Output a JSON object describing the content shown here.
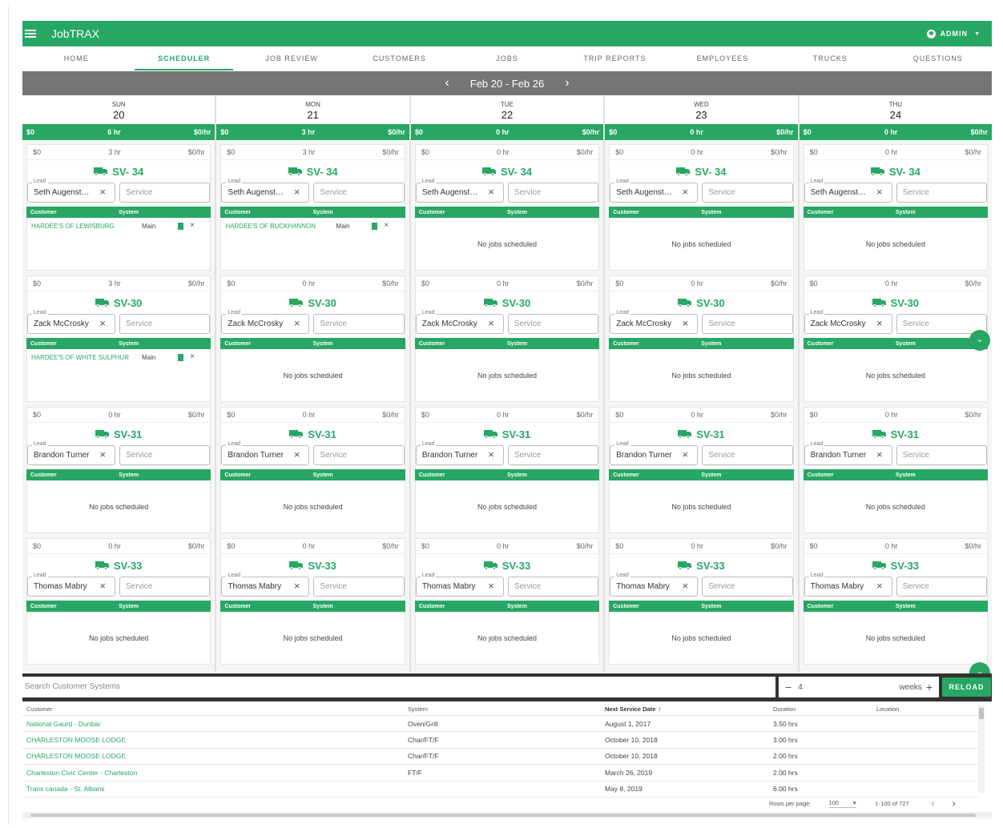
{
  "app": {
    "title": "JobTRAX",
    "user_label": "ADMIN"
  },
  "tabs": [
    "HOME",
    "SCHEDULER",
    "JOB REVIEW",
    "CUSTOMERS",
    "JOBS",
    "TRIP REPORTS",
    "EMPLOYEES",
    "TRUCKS",
    "QUESTIONS"
  ],
  "active_tab": "SCHEDULER",
  "week": {
    "label": "Feb 20 - Feb 26",
    "prev_icon": "chevron-left",
    "next_icon": "chevron-right"
  },
  "table_header": {
    "customer": "Customer",
    "system": "System"
  },
  "lead_label": "Lead",
  "service_placeholder": "Service",
  "empty_message": "No jobs scheduled",
  "colors": {
    "brand": "#27a763",
    "week_bar": "#757575",
    "bottom_bar": "#333333"
  },
  "days": [
    {
      "name": "SUN",
      "date": "20",
      "totals": {
        "revenue": "$0",
        "hours": "6 hr",
        "rate": "$0/hr"
      },
      "trucks": [
        {
          "name": "SV- 34",
          "revenue": "$0",
          "hours": "3 hr",
          "rate": "$0/hr",
          "lead": "Seth Augenstein",
          "jobs": [
            {
              "customer": "HARDEE'S OF LEWISBURG",
              "system": "Main"
            }
          ]
        },
        {
          "name": "SV-30",
          "revenue": "$0",
          "hours": "3 hr",
          "rate": "$0/hr",
          "lead": "Zack McCrosky",
          "jobs": [
            {
              "customer": "HARDEE'S OF WHITE SULPHUR",
              "system": "Main"
            }
          ]
        },
        {
          "name": "SV-31",
          "revenue": "$0",
          "hours": "0 hr",
          "rate": "$0/hr",
          "lead": "Brandon Turner",
          "jobs": []
        },
        {
          "name": "SV-33",
          "revenue": "$0",
          "hours": "0 hr",
          "rate": "$0/hr",
          "lead": "Thomas Mabry",
          "jobs": []
        }
      ]
    },
    {
      "name": "MON",
      "date": "21",
      "totals": {
        "revenue": "$0",
        "hours": "3 hr",
        "rate": "$0/hr"
      },
      "trucks": [
        {
          "name": "SV- 34",
          "revenue": "$0",
          "hours": "3 hr",
          "rate": "$0/hr",
          "lead": "Seth Augenstein",
          "jobs": [
            {
              "customer": "HARDEE'S OF BUCKHANNON",
              "system": "Main"
            }
          ]
        },
        {
          "name": "SV-30",
          "revenue": "$0",
          "hours": "0 hr",
          "rate": "$0/hr",
          "lead": "Zack McCrosky",
          "jobs": []
        },
        {
          "name": "SV-31",
          "revenue": "$0",
          "hours": "0 hr",
          "rate": "$0/hr",
          "lead": "Brandon Turner",
          "jobs": []
        },
        {
          "name": "SV-33",
          "revenue": "$0",
          "hours": "0 hr",
          "rate": "$0/hr",
          "lead": "Thomas Mabry",
          "jobs": []
        }
      ]
    },
    {
      "name": "TUE",
      "date": "22",
      "totals": {
        "revenue": "$0",
        "hours": "0 hr",
        "rate": "$0/hr"
      },
      "trucks": [
        {
          "name": "SV- 34",
          "revenue": "$0",
          "hours": "0 hr",
          "rate": "$0/hr",
          "lead": "Seth Augenstein",
          "jobs": []
        },
        {
          "name": "SV-30",
          "revenue": "$0",
          "hours": "0 hr",
          "rate": "$0/hr",
          "lead": "Zack McCrosky",
          "jobs": []
        },
        {
          "name": "SV-31",
          "revenue": "$0",
          "hours": "0 hr",
          "rate": "$0/hr",
          "lead": "Brandon Turner",
          "jobs": []
        },
        {
          "name": "SV-33",
          "revenue": "$0",
          "hours": "0 hr",
          "rate": "$0/hr",
          "lead": "Thomas Mabry",
          "jobs": []
        }
      ]
    },
    {
      "name": "WED",
      "date": "23",
      "totals": {
        "revenue": "$0",
        "hours": "0 hr",
        "rate": "$0/hr"
      },
      "trucks": [
        {
          "name": "SV- 34",
          "revenue": "$0",
          "hours": "0 hr",
          "rate": "$0/hr",
          "lead": "Seth Augenstein",
          "jobs": []
        },
        {
          "name": "SV-30",
          "revenue": "$0",
          "hours": "0 hr",
          "rate": "$0/hr",
          "lead": "Zack McCrosky",
          "jobs": []
        },
        {
          "name": "SV-31",
          "revenue": "$0",
          "hours": "0 hr",
          "rate": "$0/hr",
          "lead": "Brandon Turner",
          "jobs": []
        },
        {
          "name": "SV-33",
          "revenue": "$0",
          "hours": "0 hr",
          "rate": "$0/hr",
          "lead": "Thomas Mabry",
          "jobs": []
        }
      ]
    },
    {
      "name": "THU",
      "date": "24",
      "totals": {
        "revenue": "$0",
        "hours": "0 hr",
        "rate": "$0/hr"
      },
      "trucks": [
        {
          "name": "SV- 34",
          "revenue": "$0",
          "hours": "0 hr",
          "rate": "$0/hr",
          "lead": "Seth Augenstein",
          "jobs": []
        },
        {
          "name": "SV-30",
          "revenue": "$0",
          "hours": "0 hr",
          "rate": "$0/hr",
          "lead": "Zack McCrosky",
          "jobs": []
        },
        {
          "name": "SV-31",
          "revenue": "$0",
          "hours": "0 hr",
          "rate": "$0/hr",
          "lead": "Brandon Turner",
          "jobs": []
        },
        {
          "name": "SV-33",
          "revenue": "$0",
          "hours": "0 hr",
          "rate": "$0/hr",
          "lead": "Thomas Mabry",
          "jobs": []
        }
      ]
    }
  ],
  "search": {
    "placeholder": "Search Customer Systems"
  },
  "weeks_control": {
    "value": "4",
    "unit": "weeks"
  },
  "reload_label": "RELOAD",
  "systems_table": {
    "columns": [
      "Customer",
      "System",
      "Next Service Date",
      "Duration",
      "Location"
    ],
    "sorted_by": "Next Service Date",
    "rows": [
      {
        "customer": "National Gaurd - Dunbar",
        "system": "Oven/Grill",
        "date": "August 1, 2017",
        "duration": "3.50 hrs",
        "location": ""
      },
      {
        "customer": "CHARLESTON MOOSE LODGE",
        "system": "Char/FT/F",
        "date": "October 10, 2018",
        "duration": "3.00 hrs",
        "location": ""
      },
      {
        "customer": "CHARLESTON MOOSE LODGE",
        "system": "Char/FT/F",
        "date": "October 10, 2018",
        "duration": "2.00 hrs",
        "location": ""
      },
      {
        "customer": "Charleston Civic Center - Charleston",
        "system": "FT/F",
        "date": "March 26, 2019",
        "duration": "2.00 hrs",
        "location": ""
      },
      {
        "customer": "Trans canada - St. Albans",
        "system": "",
        "date": "May 8, 2019",
        "duration": "6.00 hrs",
        "location": ""
      }
    ]
  },
  "pagination": {
    "rows_per_page_label": "Rows per page:",
    "rows_per_page": "100",
    "range": "1-100 of 727"
  }
}
